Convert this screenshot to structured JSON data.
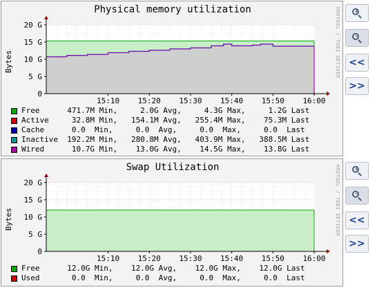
{
  "panels": {
    "memory": {
      "title": "Physical memory utilization",
      "ylabel": "Bytes",
      "side_text": "RRDTOOL / TOBI OETIKER",
      "legend": [
        {
          "name": "Free",
          "color": "#00aa00",
          "text": "Free      471.7M Min,     2.0G Avg,     4.3G Max,     1.2G Last"
        },
        {
          "name": "Active",
          "color": "#cc0000",
          "text": "Active     32.8M Min,   154.1M Avg,   255.4M Max,    75.3M Last"
        },
        {
          "name": "Cache",
          "color": "#0000aa",
          "text": "Cache      0.0  Min,     0.0  Avg,     0.0  Max,     0.0  Last"
        },
        {
          "name": "Inactive",
          "color": "#009999",
          "text": "Inactive  192.2M Min,   280.8M Avg,   403.9M Max,   388.5M Last"
        },
        {
          "name": "Wired",
          "color": "#aa00aa",
          "text": "Wired      10.7G Min,    13.0G Avg,    14.5G Max,    13.8G Last"
        }
      ]
    },
    "swap": {
      "title": "Swap Utilization",
      "ylabel": "Bytes",
      "side_text": "RRDTOOL / TOBI OETIKER",
      "legend": [
        {
          "name": "Free",
          "color": "#00aa00",
          "text": "Free      12.0G Min,    12.0G Avg,    12.0G Max,    12.0G Last"
        },
        {
          "name": "Used",
          "color": "#cc0000",
          "text": "Used       0.0  Min,     0.0  Avg,     0.0  Max,     0.0  Last"
        }
      ]
    }
  },
  "buttons": {
    "zoom_in": "zoom-in",
    "zoom_out": "zoom-out",
    "prev": "<<",
    "next": ">>"
  },
  "chart_data": [
    {
      "type": "area",
      "title": "Physical memory utilization",
      "ylabel": "Bytes",
      "ylim": [
        0,
        20
      ],
      "y_unit": "G",
      "y_ticks": [
        "0",
        "5 G",
        "10 G",
        "15 G",
        "20 G"
      ],
      "x_ticks": [
        "15:10",
        "15:20",
        "15:30",
        "15:40",
        "15:50",
        "16:00"
      ],
      "x_minutes": [
        -5,
        0,
        5,
        10,
        15,
        20,
        25,
        30,
        35,
        38,
        40,
        45,
        47,
        50,
        55,
        60
      ],
      "series": [
        {
          "name": "Wired",
          "color": "#aa00aa",
          "values": [
            10.7,
            11.1,
            11.4,
            11.9,
            12.3,
            12.6,
            13.0,
            13.3,
            13.9,
            14.4,
            13.9,
            14.1,
            14.4,
            13.8,
            13.8,
            13.8
          ]
        },
        {
          "name": "Free",
          "color": "#00aa00",
          "values": [
            15.3,
            15.3,
            15.3,
            15.3,
            15.3,
            15.3,
            15.3,
            15.3,
            15.3,
            15.3,
            15.3,
            15.3,
            15.3,
            15.3,
            15.3,
            15.3
          ]
        }
      ],
      "grid": true
    },
    {
      "type": "area",
      "title": "Swap Utilization",
      "ylabel": "Bytes",
      "ylim": [
        0,
        20
      ],
      "y_unit": "G",
      "y_ticks": [
        "0",
        "5 G",
        "10 G",
        "15 G",
        "20 G"
      ],
      "x_ticks": [
        "15:10",
        "15:20",
        "15:30",
        "15:40",
        "15:50",
        "16:00"
      ],
      "x_minutes": [
        -5,
        60
      ],
      "series": [
        {
          "name": "Free",
          "color": "#00aa00",
          "values": [
            12.0,
            12.0
          ]
        },
        {
          "name": "Used",
          "color": "#cc0000",
          "values": [
            0.0,
            0.0
          ]
        }
      ],
      "grid": true
    }
  ]
}
